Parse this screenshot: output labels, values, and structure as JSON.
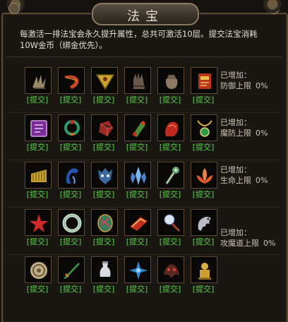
{
  "window": {
    "title": "法宝"
  },
  "description": {
    "line1": "每激活一排法宝会永久提升属性，总共可激活10层。提交法宝消耗",
    "line2": "10W金币（绑金优先）。"
  },
  "submit_label": "[提交]",
  "rows": [
    {
      "items": [
        "claw-icon",
        "horn-icon",
        "triangle-talisman-icon",
        "glove-icon",
        "pouch-icon",
        "red-scroll-icon"
      ],
      "stat_prefix": "已增加：",
      "stat_name": "防御上限",
      "stat_value": "0%"
    },
    {
      "items": [
        "purple-book-icon",
        "serpent-ring-icon",
        "red-crystal-icon",
        "fire-vial-icon",
        "red-hand-icon",
        "gem-necklace-icon"
      ],
      "stat_prefix": "已增加：",
      "stat_name": "魔防上限",
      "stat_value": "0%"
    },
    {
      "items": [
        "golden-fan-icon",
        "blue-claw-icon",
        "demon-mask-icon",
        "ice-crystal-icon",
        "jade-staff-icon",
        "lotus-flower-icon"
      ],
      "stat_prefix": "已增加：",
      "stat_name": "生命上限",
      "stat_value": "0%"
    },
    {
      "items": [
        "red-star-icon",
        "jade-ring-icon",
        "dragon-egg-icon",
        "red-tome-icon",
        "pearl-staff-icon",
        "silver-dragon-icon"
      ],
      "stat_prefix": "已增加：",
      "stat_name": "攻魔道上限",
      "stat_value": "0%"
    },
    {
      "items": [
        "spiral-disc-icon",
        "green-blade-icon",
        "white-bottle-icon",
        "blue-shuriken-icon",
        "dark-beast-icon",
        "golden-idol-icon"
      ],
      "stat_prefix": "",
      "stat_name": "",
      "stat_value": ""
    }
  ]
}
